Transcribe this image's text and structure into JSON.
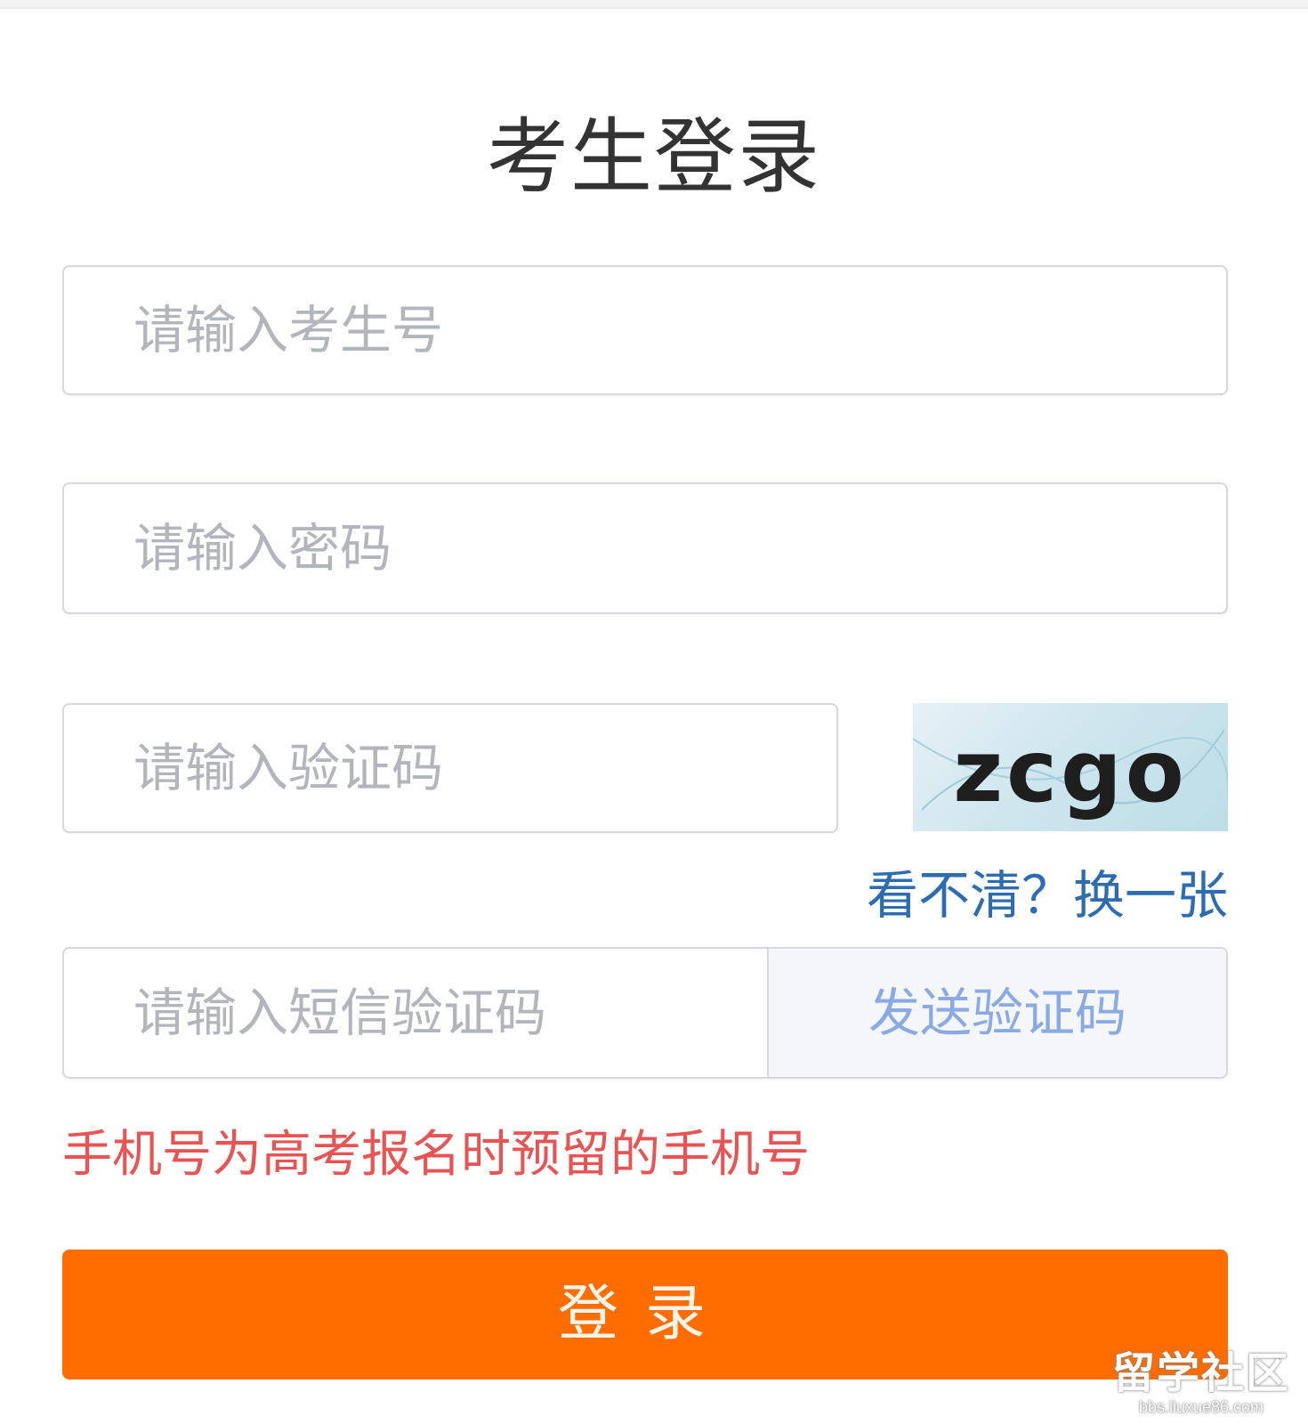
{
  "title": "考生登录",
  "form": {
    "username_placeholder": "请输入考生号",
    "password_placeholder": "请输入密码",
    "captcha_placeholder": "请输入验证码",
    "captcha_text": "zcgo",
    "captcha_refresh_label": "看不清？换一张",
    "sms_placeholder": "请输入短信验证码",
    "sms_send_label": "发送验证码",
    "phone_hint": "手机号为高考报名时预留的手机号",
    "login_label": "登录"
  },
  "watermark": {
    "main": "留学社区",
    "sub": "bbs.liuxue86.com"
  },
  "colors": {
    "accent": "#ff6c00",
    "hint": "#e85454",
    "link": "#2b6cb3",
    "send_text": "#8aaae6"
  }
}
